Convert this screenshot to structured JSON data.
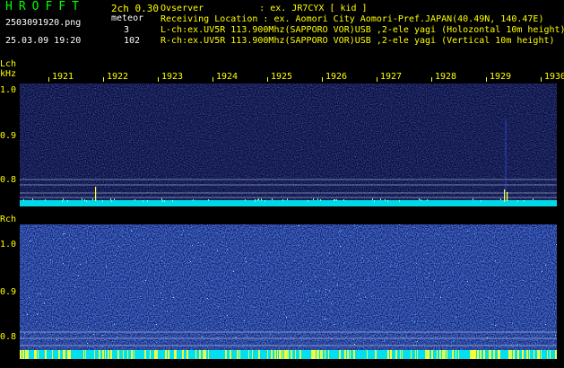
{
  "header": {
    "app_title": "HROFFT",
    "filename": "2503091920.png",
    "datetime": "25.03.09 19:20",
    "channel_version": "2ch 0.30",
    "meteor_label": "meteor",
    "l_count": "3",
    "r_count": "102",
    "lines": [
      {
        "label": "Ovserver",
        "value": ": ex. JR7CYX [ kid ]"
      },
      {
        "label": "Receiving Location",
        "value": ": ex. Aomori City Aomori-Pref.JAPAN(40.49N, 140.47E)"
      },
      {
        "label": "L-ch:ex.",
        "value": "UV5R 113.900Mhz(SAPPORO VOR)USB ,2-ele yagi (Holozontal 10m height)"
      },
      {
        "label": "R-ch:ex.",
        "value": "UV5R 113.900Mhz(SAPPORO VOR)USB ,2-ele yagi (Vertical 10m height)"
      }
    ]
  },
  "lch": {
    "label": "Lch",
    "unit": "kHz",
    "freq_labels": [
      "1.0",
      "0.9",
      "0.8"
    ]
  },
  "rch": {
    "label": "Rch",
    "freq_labels": [
      "1.0",
      "0.9",
      "0.8"
    ]
  },
  "time_ticks": [
    "1921",
    "1922",
    "1923",
    "1924",
    "1925",
    "1926",
    "1927",
    "1928",
    "1929",
    "1930"
  ],
  "colors": {
    "text_yellow": "#ffff00",
    "title_green": "#00ff00",
    "background": "#000000",
    "noise_floor": "#00ffff",
    "spectrum_blue": "#1a2aa0"
  }
}
